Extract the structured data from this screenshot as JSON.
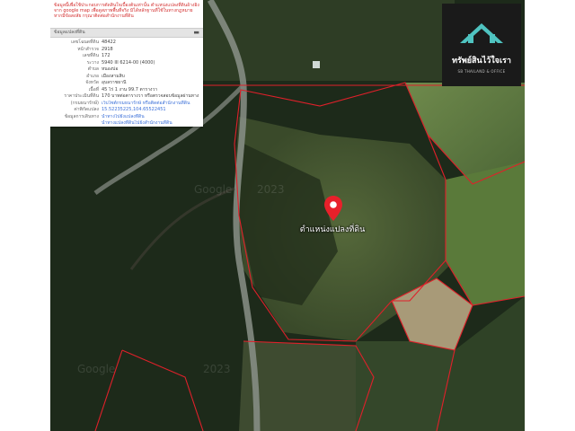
{
  "info_panel": {
    "disclaimer": "ข้อมูลนี้เพื่อใช้ประกอบการตัดสินใจเบื้องต้นเท่านั้น ตำแหน่งแปลงที่ดินอ้างอิงจาก google map เพื่อดูสภาพพื้นที่จริง มิได้หลักฐานที่ใช้ในทางกฎหมาย หากมีข้อสงสัย กรุณาติดต่อสำนักงานที่ดิน",
    "header": "ข้อมูลแปลงที่ดิน",
    "collapse_glyph": "▬",
    "rows": [
      {
        "label": "เลขโฉนดที่ดิน",
        "value": "48422"
      },
      {
        "label": "หน้าสำรวจ",
        "value": "2918"
      },
      {
        "label": "เลขที่ดิน",
        "value": "172"
      },
      {
        "label": "ระวาง",
        "value": "5940 III 6214-00 (4000)"
      },
      {
        "label": "ตำบล",
        "value": "หนองบ่อ"
      },
      {
        "label": "อำเภอ",
        "value": "เมืองสามสิบ"
      },
      {
        "label": "จังหวัด",
        "value": "อุบลราชธานี"
      },
      {
        "label": "เนื้อที่",
        "value": "45 ไร่ 1 งาน 99.7 ตารางวา"
      },
      {
        "label": "ราคาประเมินที่ดิน",
        "value": "170 บาทต่อตารางวา หรือตรวจสอบข้อมูลผ่านทาง"
      },
      {
        "label": "(กรมธนารักษ์)",
        "value": "เว็บไซต์กรมธนารักษ์ หรือติดต่อสำนักงานที่ดิน"
      },
      {
        "label": "ค่าพิกัดแปลง",
        "value": "15.52235225,104.65522451"
      },
      {
        "label": "ข้อมูลการเดินทาง",
        "value": "นำทางไปยังแปลงที่ดิน"
      }
    ],
    "extra_link": "นำทางแปลงที่ดินไปยังสำนักงานที่ดิน"
  },
  "logo": {
    "brand": "ทรัพย์สินไว้ใจเรา",
    "subtitle": "SB THAILAND & OFFICE",
    "colors": {
      "roof": "#4fc3c0",
      "bg": "#1a1a1a"
    }
  },
  "marker": {
    "label": "ตำแหน่งแปลงที่ดิน",
    "icon": "map-pin-icon",
    "color": "#e8202a"
  },
  "map": {
    "watermark": "Google",
    "watermark_year": "2023",
    "parcel_line_color": "#e0202a"
  }
}
